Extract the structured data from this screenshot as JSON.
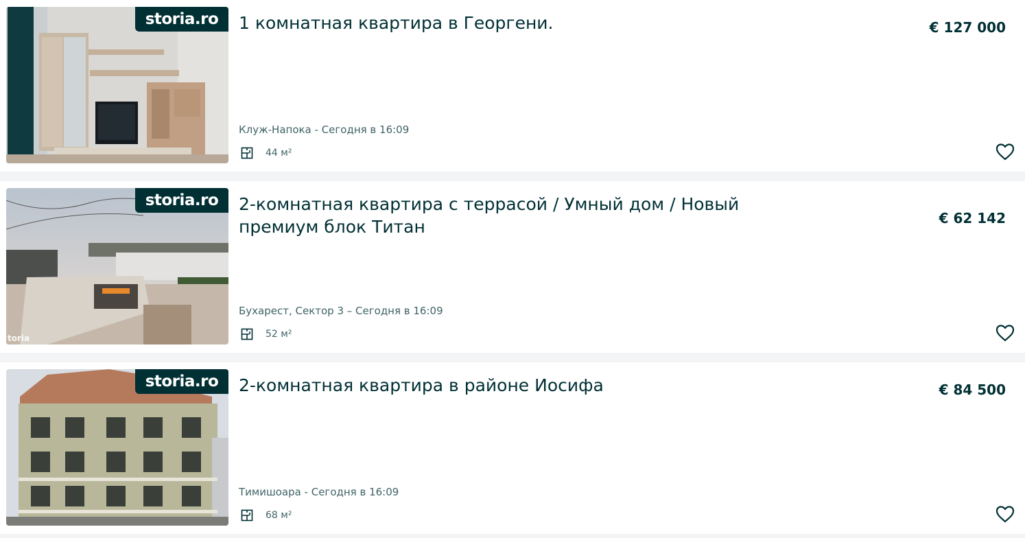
{
  "listings": [
    {
      "badge": "storia.ro",
      "title": "1 комнатная квартира в Георгени.",
      "price": "€ 127 000",
      "location": "Клуж-Напока - Сегодня в 16:09",
      "area": "44 м²",
      "area_icon": "floor-plan-icon",
      "favorite_icon": "heart-outline-icon"
    },
    {
      "badge": "storia.ro",
      "watermark": "toria",
      "title": "2-комнатная квартира с террасой / Умный дом / Новый премиум блок Титан",
      "price": "€ 62 142",
      "location": "Бухарест, Сектор 3 – Сегодня в 16:09",
      "area": "52 м²",
      "area_icon": "floor-plan-icon",
      "favorite_icon": "heart-outline-icon"
    },
    {
      "badge": "storia.ro",
      "title": "2-комнатная квартира в районе Иосифа",
      "price": "€ 84 500",
      "location": "Тимишоара - Сегодня в 16:09",
      "area": "68 м²",
      "area_icon": "floor-plan-icon",
      "favorite_icon": "heart-outline-icon"
    }
  ],
  "colors": {
    "text": "#002f34",
    "muted": "#406367",
    "badge_bg": "#002f34",
    "page_bg": "#f2f4f5",
    "card_bg": "#ffffff"
  }
}
